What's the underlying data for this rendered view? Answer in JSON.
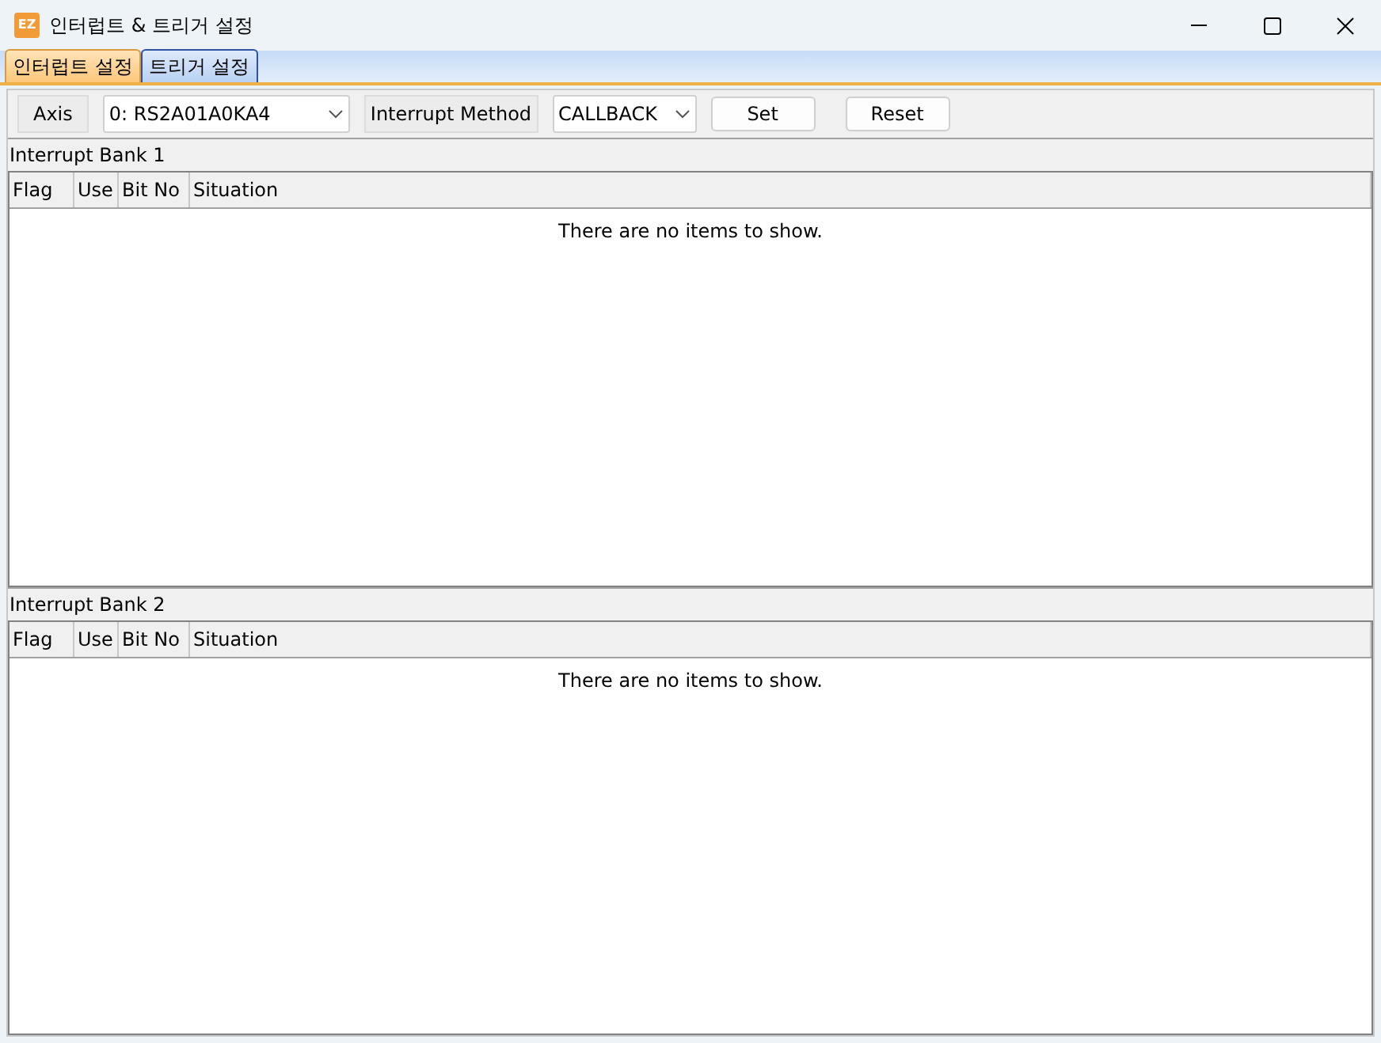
{
  "window": {
    "title": "인터럽트 & 트리거 설정",
    "app_icon": "EZ"
  },
  "tabs": [
    {
      "label": "인터럽트 설정",
      "selected": true
    },
    {
      "label": "트리거 설정",
      "selected": false
    }
  ],
  "toolbar": {
    "axis_label": "Axis",
    "axis_value": "0: RS2A01A0KA4",
    "method_label": "Interrupt Method",
    "method_value": "CALLBACK",
    "buttons": [
      "Set",
      "Reset"
    ]
  },
  "banks": [
    {
      "title": "Interrupt Bank 1",
      "columns": [
        "Flag",
        "Use",
        "Bit No",
        "Situation"
      ],
      "empty_message": "There are no items to show."
    },
    {
      "title": "Interrupt Bank 2",
      "columns": [
        "Flag",
        "Use",
        "Bit No",
        "Situation"
      ],
      "empty_message": "There are no items to show."
    }
  ]
}
